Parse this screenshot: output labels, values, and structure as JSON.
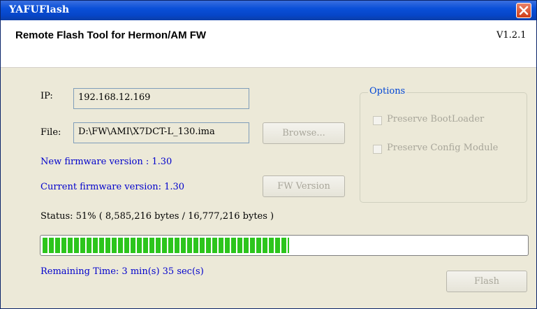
{
  "window": {
    "title": "YAFUFlash",
    "header_title": "Remote Flash Tool for Hermon/AM FW",
    "version": "V1.2.1"
  },
  "form": {
    "ip_label": "IP:",
    "ip_value": "192.168.12.169",
    "file_label": "File:",
    "file_value": "D:\\FW\\AMI\\X7DCT-L_130.ima",
    "browse_label": "Browse...",
    "new_fw_text": "New firmware version : 1.30",
    "current_fw_text": "Current firmware version: 1.30",
    "fw_version_button": "FW Version"
  },
  "options": {
    "legend": "Options",
    "preserve_bootloader": "Preserve BootLoader",
    "preserve_config": "Preserve Config Module"
  },
  "progress": {
    "status_text": "Status: 51% ( 8,585,216 bytes / 16,777,216 bytes )",
    "fraction": 0.51,
    "remaining_text": "Remaining Time: 3 min(s) 35 sec(s)"
  },
  "actions": {
    "flash_label": "Flash"
  },
  "colors": {
    "title_bar": "#0a4fd8",
    "progress_fill": "#2cc51c",
    "info_text": "#0000cc"
  },
  "icons": {
    "close": "close-icon"
  }
}
